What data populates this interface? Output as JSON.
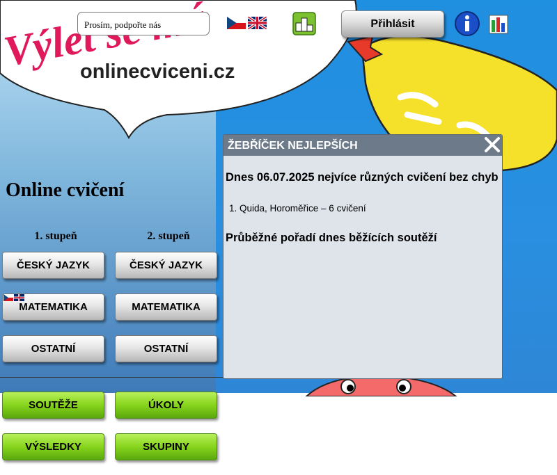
{
  "header": {
    "logo_script": "Výlet se má",
    "logo_site": "onlinecviceni.cz",
    "donate_label": "Prosím, podpořte nás",
    "login_label": "Přihlásit"
  },
  "main": {
    "title": "Online cvičení",
    "stages": [
      "1. stupeň",
      "2. stupeň"
    ],
    "col1": [
      "ČESKÝ JAZYK",
      "MATEMATIKA",
      "OSTATNÍ"
    ],
    "col2": [
      "ČESKÝ JAZYK",
      "MATEMATIKA",
      "OSTATNÍ"
    ],
    "green": [
      "SOUTĚŽE",
      "ÚKOLY",
      "VÝSLEDKY",
      "SKUPINY"
    ]
  },
  "panel": {
    "title": "ŽEBŘÍČEK NEJLEPŠÍCH",
    "best_heading": "Dnes 06.07.2025 nejvíce různých cvičení bez chyb",
    "best_list": [
      "1. Quida, Horoměřice – 6 cvičení"
    ],
    "contest_heading": "Průběžné pořadí dnes běžících soutěží"
  },
  "icons": {
    "flag_cz": "czech-flag-icon",
    "flag_en": "uk-flag-icon",
    "stats": "podium-icon",
    "info": "info-icon",
    "results": "bar-chart-icon",
    "close": "close-icon"
  },
  "colors": {
    "logo_pink": "#e0195a",
    "panel_header": "#6d7a89",
    "panel_bg": "#dfe4ea",
    "green_button": "#86d41c",
    "bird_yellow": "#f5e12a"
  }
}
